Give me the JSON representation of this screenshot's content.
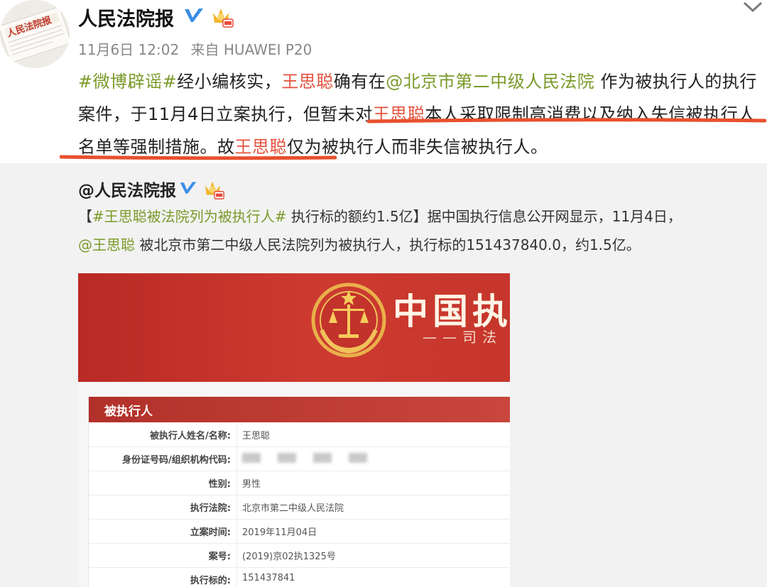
{
  "post": {
    "author": "人民法院报",
    "date": "11月6日 12:02",
    "source": "来自 HUAWEI P20",
    "segments": {
      "tag": "#微博辟谣#",
      "t1": "经小编核实，",
      "name1": "王思聪",
      "t2": "确有在",
      "mention": "@北京市第二中级人民法院",
      "t3": " 作为被执行人的执行案件，于11月4日立案执行，",
      "t4": "但暂未对",
      "name2": "王思聪",
      "t5": "本人采取限制高消费以及纳入失信被执行人名单等强制措施",
      "t6": "。故",
      "name3": "王思聪",
      "t7": "仅为被执行人而非失信被执行人。"
    }
  },
  "repost": {
    "author": "@人民法院报",
    "segments": {
      "b1": "【",
      "tag": "#王思聪被法院列为被执行人#",
      "t1": " 执行标的额约1.5亿】据中国执行信息公开网显示，11月4日，",
      "mention": "@王思聪",
      "t2": " 被北京市第二中级人民法院列为被执行人，执行标的151437840.0，约1.5亿。"
    }
  },
  "screenshot": {
    "title": "中国执行",
    "subtitle": "——司法",
    "panel_title": "被执行人",
    "rows": [
      {
        "label": "被执行人姓名/名称:",
        "value": "王思聪"
      },
      {
        "label": "身份证号码/组织机构代码:",
        "value": ""
      },
      {
        "label": "性别:",
        "value": "男性"
      },
      {
        "label": "执行法院:",
        "value": "北京市第二中级人民法院"
      },
      {
        "label": "立案时间:",
        "value": "2019年11月04日"
      },
      {
        "label": "案号:",
        "value": "(2019)京02执1325号"
      },
      {
        "label": "执行标的:",
        "value": "151437841"
      }
    ]
  },
  "icons": {
    "verified": "verified-v-icon",
    "vip": "vip-crown-icon",
    "chevron": "chevron-down-icon"
  },
  "colors": {
    "tag": "#7a9a2a",
    "name": "#e4513d",
    "underline": "#e8502e",
    "banner": "#c6362c"
  }
}
